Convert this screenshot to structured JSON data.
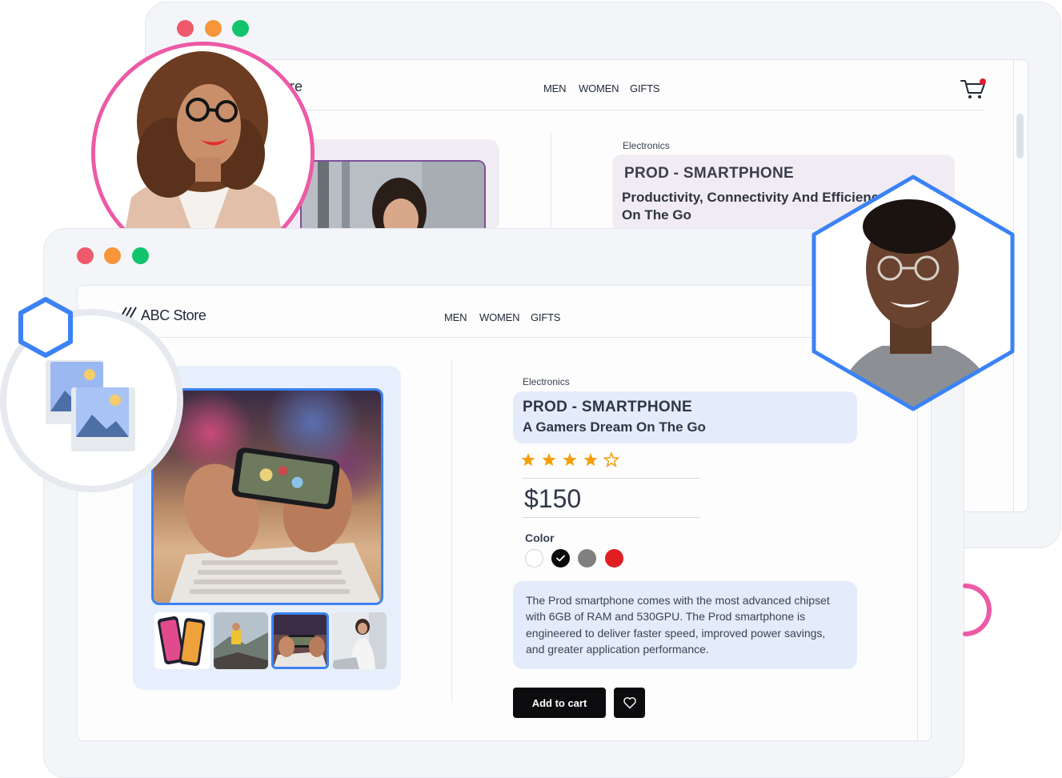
{
  "colors": {
    "traffic_red": "#ee5a6c",
    "traffic_orange": "#f7953b",
    "traffic_green": "#12c46c",
    "accent_blue": "#3b82f6",
    "accent_pink": "#ec5aa6",
    "star": "#f59e0b",
    "button_dark": "#0c0c0f"
  },
  "back_window": {
    "logo_fragment": "re",
    "nav": [
      "MEN",
      "WOMEN",
      "GIFTS"
    ],
    "cart_icon": "shopping-cart-icon",
    "category": "Electronics",
    "title": "PROD - SMARTPHONE",
    "subtitle": "Productivity, Connectivity And Efficienc",
    "subtitle_line2": "On The Go"
  },
  "front_window": {
    "logo": "ABC Store",
    "logo_icon": "slash-logo-icon",
    "nav": [
      "MEN",
      "WOMEN",
      "GIFTS"
    ],
    "category": "Electronics",
    "title": "PROD - SMARTPHONE",
    "subtitle": "A Gamers Dream On The Go",
    "rating": 4,
    "rating_max": 5,
    "price": "$150",
    "color_label": "Color",
    "colors": [
      {
        "hex": "#ffffff",
        "selected": false
      },
      {
        "hex": "#0a0a0a",
        "selected": true
      },
      {
        "hex": "#808080",
        "selected": false
      },
      {
        "hex": "#e01e24",
        "selected": false
      }
    ],
    "description": "The Prod smartphone comes with the most advanced chipset with 6GB of RAM and 530GPU. The Prod smartphone is engineered to deliver faster speed, improved power savings, and greater application performance.",
    "add_to_cart": "Add to cart",
    "favorite_icon": "heart-icon",
    "selected_thumbnail": 3
  },
  "decorations": {
    "image_badge_icon": "image-gallery-icon"
  }
}
